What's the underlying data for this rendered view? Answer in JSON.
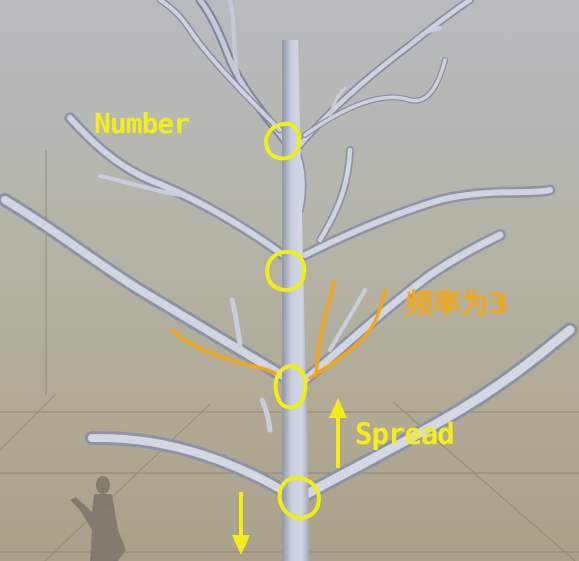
{
  "viewport": {
    "description_tag": "3D editor scene view"
  },
  "annotations": {
    "number_label": "Number",
    "frequency_label": "频率为3",
    "spread_label": "Spread"
  },
  "colors": {
    "sky_top": "#b9bdc0",
    "sky_bottom": "#b5ae94",
    "ground": "#a9a08a",
    "grid_line": "#8c8573",
    "tree": "#c6ccdb",
    "tree_shadow": "#8e94a6",
    "annotation_yellow": "#f2ee1a",
    "annotation_orange": "#f0a81a",
    "silhouette": "#7a7569"
  },
  "icons": {
    "circle_marker": "circle-marker-icon",
    "arrow_up": "arrow-up-icon",
    "arrow_down": "arrow-down-icon",
    "scale_figure": "human-silhouette-icon"
  }
}
